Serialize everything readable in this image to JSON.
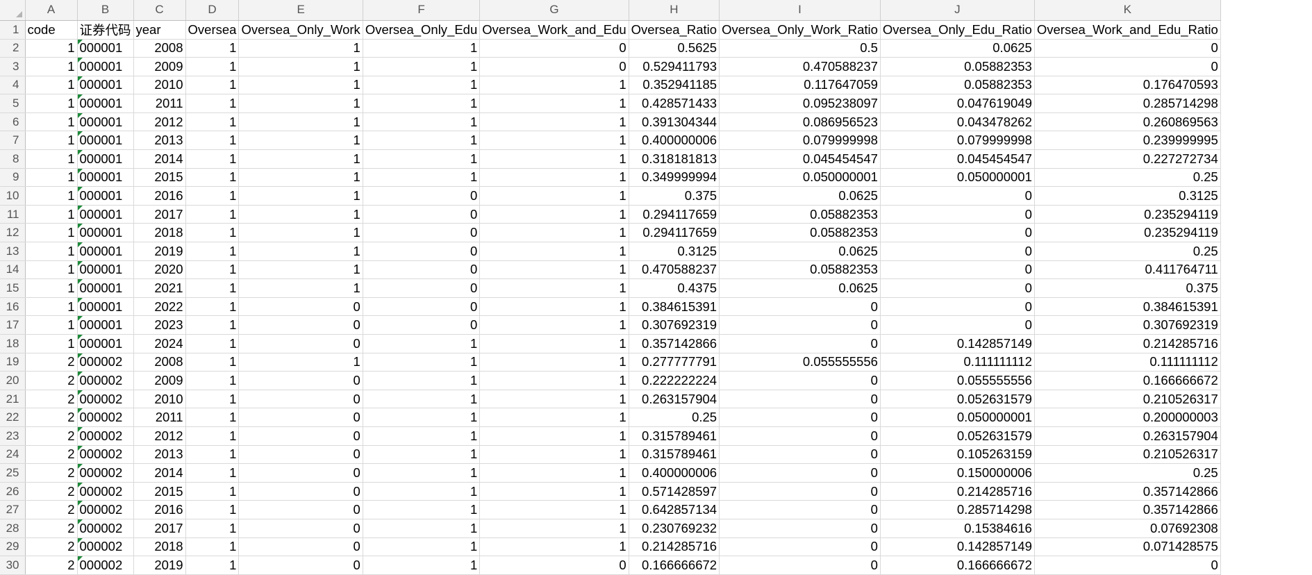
{
  "columns": [
    "A",
    "B",
    "C",
    "D",
    "E",
    "F",
    "G",
    "H",
    "I",
    "J",
    "K"
  ],
  "header_row_label": "1",
  "headers": [
    "code",
    "证券代码",
    "year",
    "Oversea",
    "Oversea_Only_Work",
    "Oversea_Only_Edu",
    "Oversea_Work_and_Edu",
    "Oversea_Ratio",
    "Oversea_Only_Work_Ratio",
    "Oversea_Only_Edu_Ratio",
    "Oversea_Work_and_Edu_Ratio"
  ],
  "rows": [
    [
      "2",
      "1",
      "000001",
      "2008",
      "1",
      "1",
      "1",
      "0",
      "0.5625",
      "0.5",
      "0.0625",
      "0"
    ],
    [
      "3",
      "1",
      "000001",
      "2009",
      "1",
      "1",
      "1",
      "0",
      "0.529411793",
      "0.470588237",
      "0.05882353",
      "0"
    ],
    [
      "4",
      "1",
      "000001",
      "2010",
      "1",
      "1",
      "1",
      "1",
      "0.352941185",
      "0.117647059",
      "0.05882353",
      "0.176470593"
    ],
    [
      "5",
      "1",
      "000001",
      "2011",
      "1",
      "1",
      "1",
      "1",
      "0.428571433",
      "0.095238097",
      "0.047619049",
      "0.285714298"
    ],
    [
      "6",
      "1",
      "000001",
      "2012",
      "1",
      "1",
      "1",
      "1",
      "0.391304344",
      "0.086956523",
      "0.043478262",
      "0.260869563"
    ],
    [
      "7",
      "1",
      "000001",
      "2013",
      "1",
      "1",
      "1",
      "1",
      "0.400000006",
      "0.079999998",
      "0.079999998",
      "0.239999995"
    ],
    [
      "8",
      "1",
      "000001",
      "2014",
      "1",
      "1",
      "1",
      "1",
      "0.318181813",
      "0.045454547",
      "0.045454547",
      "0.227272734"
    ],
    [
      "9",
      "1",
      "000001",
      "2015",
      "1",
      "1",
      "1",
      "1",
      "0.349999994",
      "0.050000001",
      "0.050000001",
      "0.25"
    ],
    [
      "10",
      "1",
      "000001",
      "2016",
      "1",
      "1",
      "0",
      "1",
      "0.375",
      "0.0625",
      "0",
      "0.3125"
    ],
    [
      "11",
      "1",
      "000001",
      "2017",
      "1",
      "1",
      "0",
      "1",
      "0.294117659",
      "0.05882353",
      "0",
      "0.235294119"
    ],
    [
      "12",
      "1",
      "000001",
      "2018",
      "1",
      "1",
      "0",
      "1",
      "0.294117659",
      "0.05882353",
      "0",
      "0.235294119"
    ],
    [
      "13",
      "1",
      "000001",
      "2019",
      "1",
      "1",
      "0",
      "1",
      "0.3125",
      "0.0625",
      "0",
      "0.25"
    ],
    [
      "14",
      "1",
      "000001",
      "2020",
      "1",
      "1",
      "0",
      "1",
      "0.470588237",
      "0.05882353",
      "0",
      "0.411764711"
    ],
    [
      "15",
      "1",
      "000001",
      "2021",
      "1",
      "1",
      "0",
      "1",
      "0.4375",
      "0.0625",
      "0",
      "0.375"
    ],
    [
      "16",
      "1",
      "000001",
      "2022",
      "1",
      "0",
      "0",
      "1",
      "0.384615391",
      "0",
      "0",
      "0.384615391"
    ],
    [
      "17",
      "1",
      "000001",
      "2023",
      "1",
      "0",
      "0",
      "1",
      "0.307692319",
      "0",
      "0",
      "0.307692319"
    ],
    [
      "18",
      "1",
      "000001",
      "2024",
      "1",
      "0",
      "1",
      "1",
      "0.357142866",
      "0",
      "0.142857149",
      "0.214285716"
    ],
    [
      "19",
      "2",
      "000002",
      "2008",
      "1",
      "1",
      "1",
      "1",
      "0.277777791",
      "0.055555556",
      "0.111111112",
      "0.111111112"
    ],
    [
      "20",
      "2",
      "000002",
      "2009",
      "1",
      "0",
      "1",
      "1",
      "0.222222224",
      "0",
      "0.055555556",
      "0.166666672"
    ],
    [
      "21",
      "2",
      "000002",
      "2010",
      "1",
      "0",
      "1",
      "1",
      "0.263157904",
      "0",
      "0.052631579",
      "0.210526317"
    ],
    [
      "22",
      "2",
      "000002",
      "2011",
      "1",
      "0",
      "1",
      "1",
      "0.25",
      "0",
      "0.050000001",
      "0.200000003"
    ],
    [
      "23",
      "2",
      "000002",
      "2012",
      "1",
      "0",
      "1",
      "1",
      "0.315789461",
      "0",
      "0.052631579",
      "0.263157904"
    ],
    [
      "24",
      "2",
      "000002",
      "2013",
      "1",
      "0",
      "1",
      "1",
      "0.315789461",
      "0",
      "0.105263159",
      "0.210526317"
    ],
    [
      "25",
      "2",
      "000002",
      "2014",
      "1",
      "0",
      "1",
      "1",
      "0.400000006",
      "0",
      "0.150000006",
      "0.25"
    ],
    [
      "26",
      "2",
      "000002",
      "2015",
      "1",
      "0",
      "1",
      "1",
      "0.571428597",
      "0",
      "0.214285716",
      "0.357142866"
    ],
    [
      "27",
      "2",
      "000002",
      "2016",
      "1",
      "0",
      "1",
      "1",
      "0.642857134",
      "0",
      "0.285714298",
      "0.357142866"
    ],
    [
      "28",
      "2",
      "000002",
      "2017",
      "1",
      "0",
      "1",
      "1",
      "0.230769232",
      "0",
      "0.15384616",
      "0.07692308"
    ],
    [
      "29",
      "2",
      "000002",
      "2018",
      "1",
      "0",
      "1",
      "1",
      "0.214285716",
      "0",
      "0.142857149",
      "0.071428575"
    ],
    [
      "30",
      "2",
      "000002",
      "2019",
      "1",
      "0",
      "1",
      "0",
      "0.166666672",
      "0",
      "0.166666672",
      "0"
    ]
  ],
  "colors": {
    "header_bg": "#f3f3f3",
    "grid": "#d9d9d9",
    "error_flag": "#1e8a3a"
  }
}
